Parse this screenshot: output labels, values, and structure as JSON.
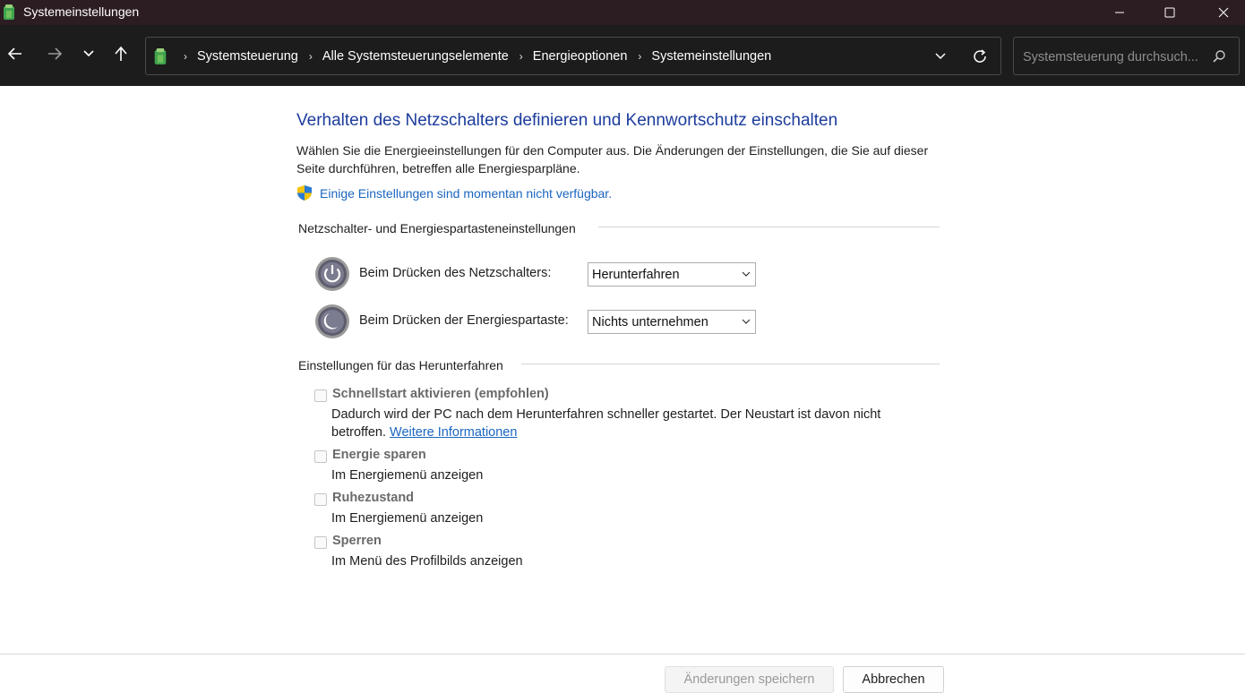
{
  "window": {
    "title": "Systemeinstellungen",
    "minimize_glyph": "—",
    "maximize_glyph": "☐",
    "close_glyph": "✕"
  },
  "nav": {
    "back_icon": "arrow-left-icon",
    "forward_icon": "arrow-right-icon",
    "recent_icon": "chevron-down-icon",
    "up_icon": "arrow-up-icon"
  },
  "address": {
    "icon": "control-panel-icon",
    "crumbs": [
      "Systemsteuerung",
      "Alle Systemsteuerungselemente",
      "Energieoptionen",
      "Systemeinstellungen"
    ],
    "separator": "›"
  },
  "search": {
    "placeholder": "Systemsteuerung durchsuch..."
  },
  "main": {
    "heading": "Verhalten des Netzschalters definieren und Kennwortschutz einschalten",
    "description": "Wählen Sie die Energieeinstellungen für den Computer aus. Die Änderungen der Einstellungen, die Sie auf dieser Seite durchführen, betreffen alle Energiesparpläne.",
    "notice_link": "Einige Einstellungen sind momentan nicht verfügbar."
  },
  "power_buttons": {
    "group_title": "Netzschalter- und Energiespartasteneinstellungen",
    "rows": [
      {
        "label": "Beim Drücken des Netzschalters:",
        "value": "Herunterfahren",
        "icon": "power-button-icon"
      },
      {
        "label": "Beim Drücken der Energiespartaste:",
        "value": "Nichts unternehmen",
        "icon": "sleep-button-icon"
      }
    ]
  },
  "shutdown": {
    "group_title": "Einstellungen für das Herunterfahren",
    "items": [
      {
        "title": "Schnellstart aktivieren (empfohlen)",
        "desc": "Dadurch wird der PC nach dem Herunterfahren schneller gestartet. Der Neustart ist davon nicht betroffen.",
        "link": "Weitere Informationen",
        "checked": false
      },
      {
        "title": "Energie sparen",
        "desc": "Im Energiemenü anzeigen",
        "checked": false
      },
      {
        "title": "Ruhezustand",
        "desc": "Im Energiemenü anzeigen",
        "checked": false
      },
      {
        "title": "Sperren",
        "desc": "Im Menü des Profilbilds anzeigen",
        "checked": false
      }
    ]
  },
  "footer": {
    "save_label": "Änderungen speichern",
    "cancel_label": "Abbrechen"
  },
  "colors": {
    "titlebar_bg": "#2c1d22",
    "toolbar_bg": "#1c1c1c",
    "heading": "#1c3c9c",
    "link": "#1a65c0"
  }
}
